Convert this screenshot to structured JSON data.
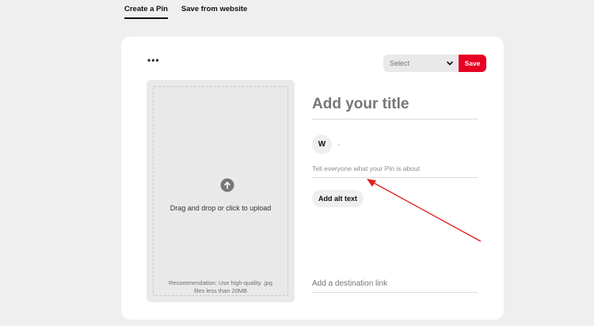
{
  "tabs": [
    {
      "label": "Create a Pin",
      "active": true
    },
    {
      "label": "Save from website",
      "active": false
    }
  ],
  "toolbar": {
    "more_label": "•••",
    "board_select_value": "Select",
    "save_label": "Save"
  },
  "upload": {
    "prompt": "Drag and drop or click to upload",
    "recommendation": "Recommendation: Use high-quality .jpg files less than 20MB"
  },
  "form": {
    "title_placeholder": "Add your title",
    "avatar_initial": "W",
    "description_placeholder": "Tell everyone what your Pin is about",
    "alt_text_label": "Add alt text",
    "destination_placeholder": "Add a destination link"
  },
  "colors": {
    "accent": "#e60023",
    "annotation_arrow": "#e02020"
  },
  "icons": {
    "upload": "arrow-up-circle-icon",
    "chevron": "chevron-down-icon",
    "more": "more-dots-icon"
  }
}
